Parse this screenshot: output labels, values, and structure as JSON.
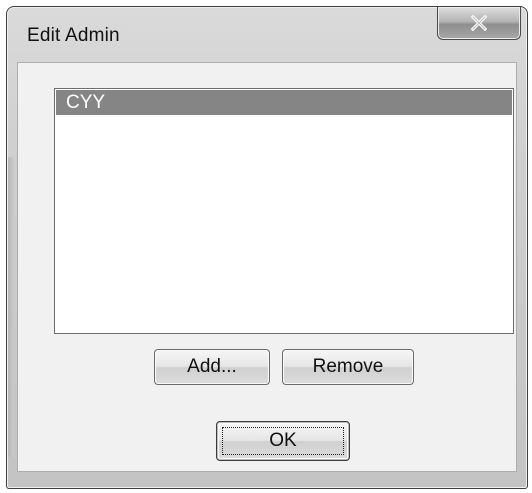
{
  "window": {
    "title": "Edit Admin"
  },
  "titlebar": {
    "close_icon": "close-icon"
  },
  "admin_list": {
    "items": [
      {
        "label": "CYY",
        "selected": true
      }
    ]
  },
  "buttons": {
    "add_label": "Add...",
    "remove_label": "Remove",
    "ok_label": "OK"
  },
  "colors": {
    "selection": "#858585",
    "selection_text": "#ffffff"
  }
}
